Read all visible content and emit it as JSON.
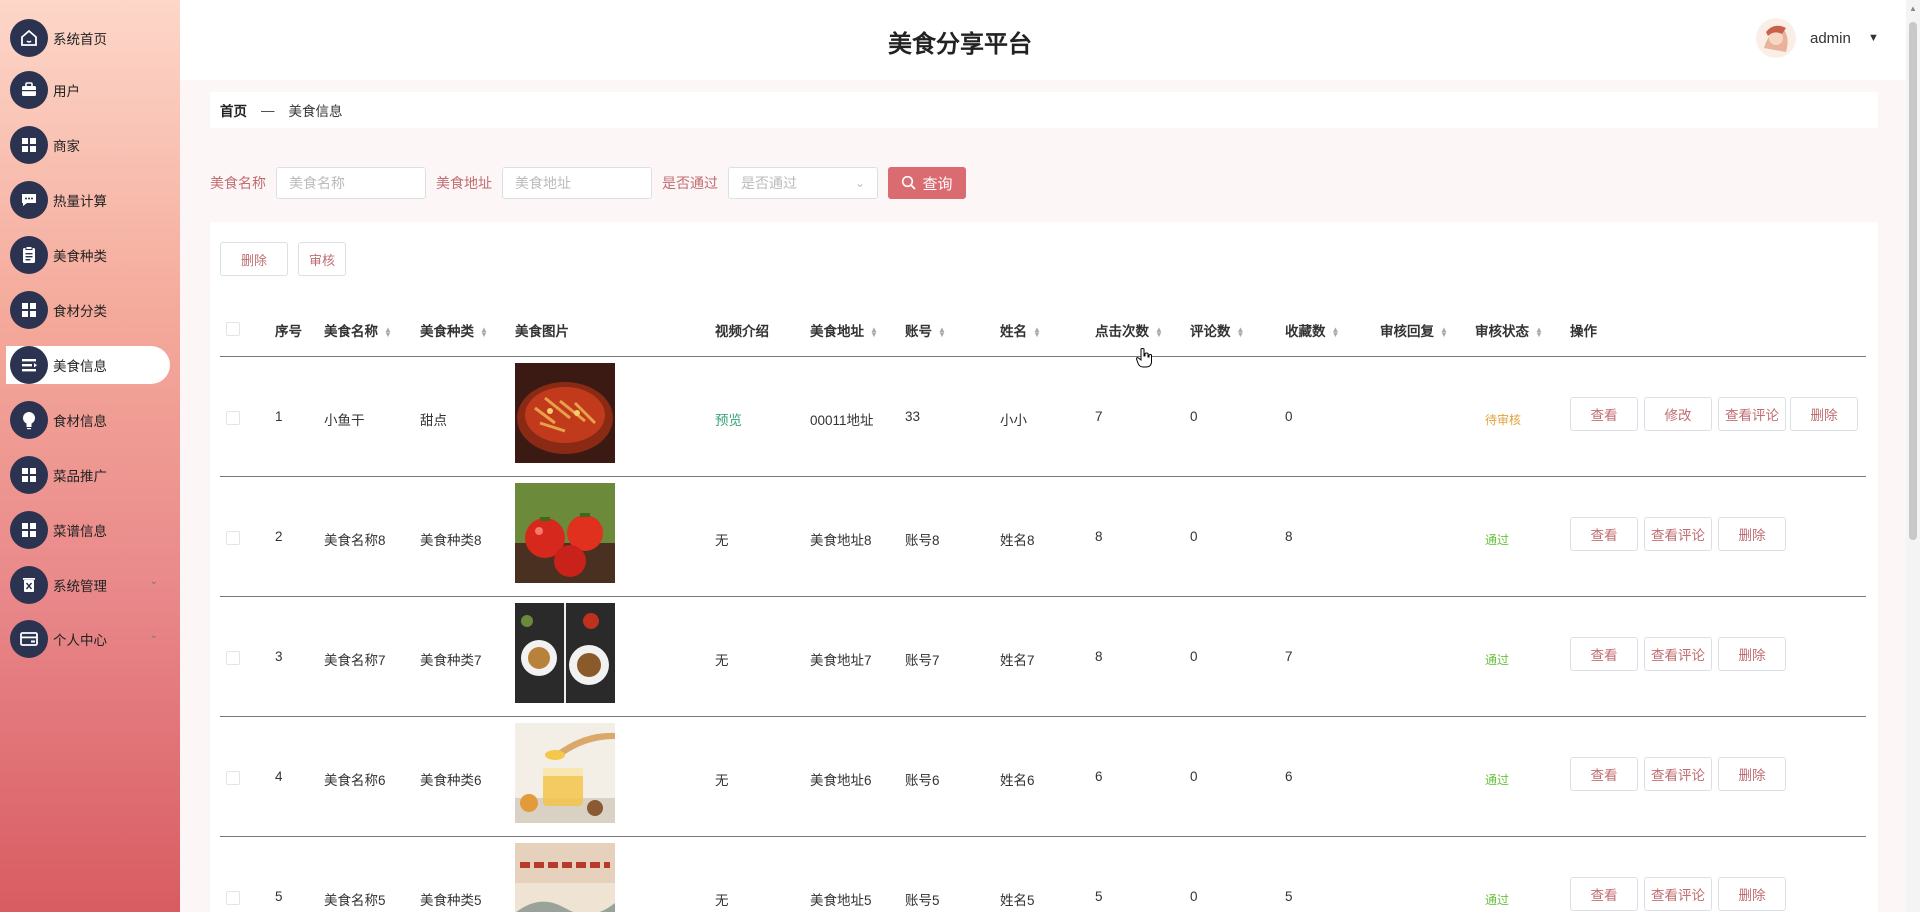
{
  "sidebar": {
    "items": [
      {
        "label": "系统首页",
        "icon": "home-icon"
      },
      {
        "label": "用户",
        "icon": "briefcase-icon"
      },
      {
        "label": "商家",
        "icon": "grid-icon"
      },
      {
        "label": "热量计算",
        "icon": "chat-icon"
      },
      {
        "label": "美食种类",
        "icon": "clipboard-icon"
      },
      {
        "label": "食材分类",
        "icon": "grid-icon"
      },
      {
        "label": "美食信息",
        "icon": "list-icon",
        "active": true
      },
      {
        "label": "食材信息",
        "icon": "bulb-icon"
      },
      {
        "label": "菜品推广",
        "icon": "grid-icon"
      },
      {
        "label": "菜谱信息",
        "icon": "grid-icon"
      },
      {
        "label": "系统管理",
        "icon": "trash-icon",
        "expandable": true
      },
      {
        "label": "个人中心",
        "icon": "card-icon",
        "expandable": true
      }
    ]
  },
  "header": {
    "title": "美食分享平台",
    "user": "admin"
  },
  "breadcrumb": {
    "home": "首页",
    "separator": "—",
    "current": "美食信息"
  },
  "search": {
    "name_label": "美食名称",
    "name_placeholder": "美食名称",
    "address_label": "美食地址",
    "address_placeholder": "美食地址",
    "passed_label": "是否通过",
    "passed_placeholder": "是否通过",
    "button": "查询"
  },
  "actions": {
    "delete": "删除",
    "review": "审核"
  },
  "table": {
    "headers": {
      "index": "序号",
      "name": "美食名称",
      "category": "美食种类",
      "image": "美食图片",
      "video": "视频介绍",
      "address": "美食地址",
      "account": "账号",
      "person": "姓名",
      "clicks": "点击次数",
      "comments": "评论数",
      "favorites": "收藏数",
      "reply": "审核回复",
      "status": "审核状态",
      "ops": "操作"
    },
    "rows": [
      {
        "index": "1",
        "name": "小鱼干",
        "category": "甜点",
        "video": "预览",
        "address": "00011地址",
        "account": "33",
        "person": "小小",
        "clicks": "7",
        "comments": "0",
        "favorites": "0",
        "status": "待审核",
        "ops": [
          "查看",
          "修改",
          "查看评论",
          "删除"
        ]
      },
      {
        "index": "2",
        "name": "美食名称8",
        "category": "美食种类8",
        "video": "无",
        "address": "美食地址8",
        "account": "账号8",
        "person": "姓名8",
        "clicks": "8",
        "comments": "0",
        "favorites": "8",
        "status": "通过",
        "ops": [
          "查看",
          "查看评论",
          "删除"
        ]
      },
      {
        "index": "3",
        "name": "美食名称7",
        "category": "美食种类7",
        "video": "无",
        "address": "美食地址7",
        "account": "账号7",
        "person": "姓名7",
        "clicks": "8",
        "comments": "0",
        "favorites": "7",
        "status": "通过",
        "ops": [
          "查看",
          "查看评论",
          "删除"
        ]
      },
      {
        "index": "4",
        "name": "美食名称6",
        "category": "美食种类6",
        "video": "无",
        "address": "美食地址6",
        "account": "账号6",
        "person": "姓名6",
        "clicks": "6",
        "comments": "0",
        "favorites": "6",
        "status": "通过",
        "ops": [
          "查看",
          "查看评论",
          "删除"
        ]
      },
      {
        "index": "5",
        "name": "美食名称5",
        "category": "美食种类5",
        "video": "无",
        "address": "美食地址5",
        "account": "账号5",
        "person": "姓名5",
        "clicks": "5",
        "comments": "0",
        "favorites": "5",
        "status": "通过",
        "ops": [
          "查看",
          "查看评论",
          "删除"
        ]
      }
    ]
  },
  "colors": {
    "accent": "#d96b71",
    "sidebar_icon_bg": "#2b3350",
    "status_pending": "#e6a23c",
    "status_ok": "#67c23a"
  }
}
